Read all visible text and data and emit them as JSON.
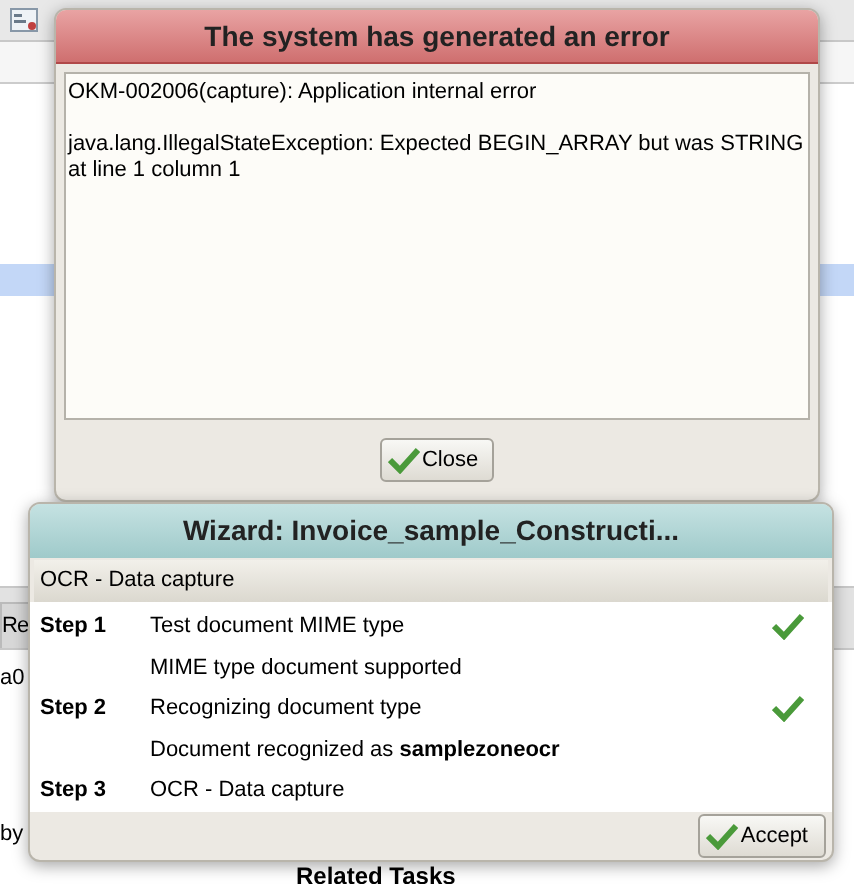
{
  "background": {
    "tab": "Re",
    "cell": "a0",
    "author": "by",
    "section_title": "Related Tasks"
  },
  "error_dialog": {
    "title": "The system has generated an error",
    "message": "OKM-002006(capture): Application internal error",
    "detail": "java.lang.IllegalStateException: Expected BEGIN_ARRAY but was STRING at line 1 column 1",
    "button": "Close"
  },
  "wizard": {
    "title": "Wizard: Invoice_sample_Constructi...",
    "section": "OCR - Data capture",
    "rows": [
      {
        "kind": "step",
        "label": "Step 1",
        "text": "Test document MIME type",
        "done": true
      },
      {
        "kind": "detail",
        "text": "MIME type document supported"
      },
      {
        "kind": "step",
        "label": "Step 2",
        "text": "Recognizing document type",
        "done": true
      },
      {
        "kind": "detail",
        "text": "Document recognized as **samplezoneocr**"
      },
      {
        "kind": "step",
        "label": "Step 3",
        "text": "OCR - Data capture",
        "done": false
      }
    ],
    "button": "Accept"
  }
}
